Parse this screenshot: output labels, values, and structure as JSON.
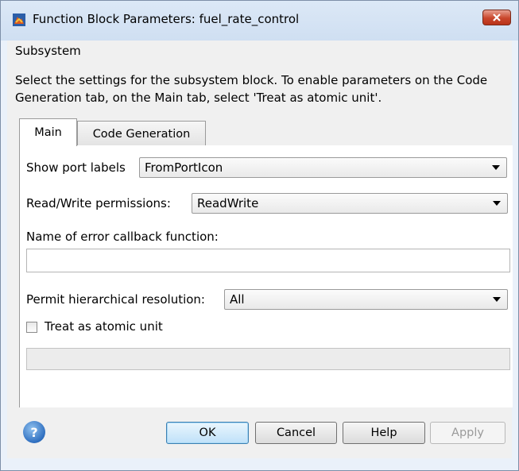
{
  "window": {
    "title": "Function Block Parameters: fuel_rate_control"
  },
  "group": {
    "label": "Subsystem",
    "description": "Select the settings for the subsystem block. To enable parameters on the Code Generation tab, on the Main tab, select 'Treat as atomic unit'."
  },
  "tabs": {
    "main": "Main",
    "code_generation": "Code Generation"
  },
  "main": {
    "show_port_labels": {
      "label": "Show port labels",
      "value": "FromPortIcon"
    },
    "read_write": {
      "label": "Read/Write permissions:",
      "value": "ReadWrite"
    },
    "error_callback": {
      "label": "Name of error callback function:",
      "value": ""
    },
    "hierarchical_resolution": {
      "label": "Permit hierarchical resolution:",
      "value": "All"
    },
    "atomic_unit": {
      "label": "Treat as atomic unit",
      "checked": false
    }
  },
  "buttons": {
    "ok": "OK",
    "cancel": "Cancel",
    "help": "Help",
    "apply": "Apply"
  },
  "colors": {
    "close_button": "#c9462c",
    "ok_button_border": "#3c7fb1",
    "help_icon": "#2f6fc0"
  }
}
